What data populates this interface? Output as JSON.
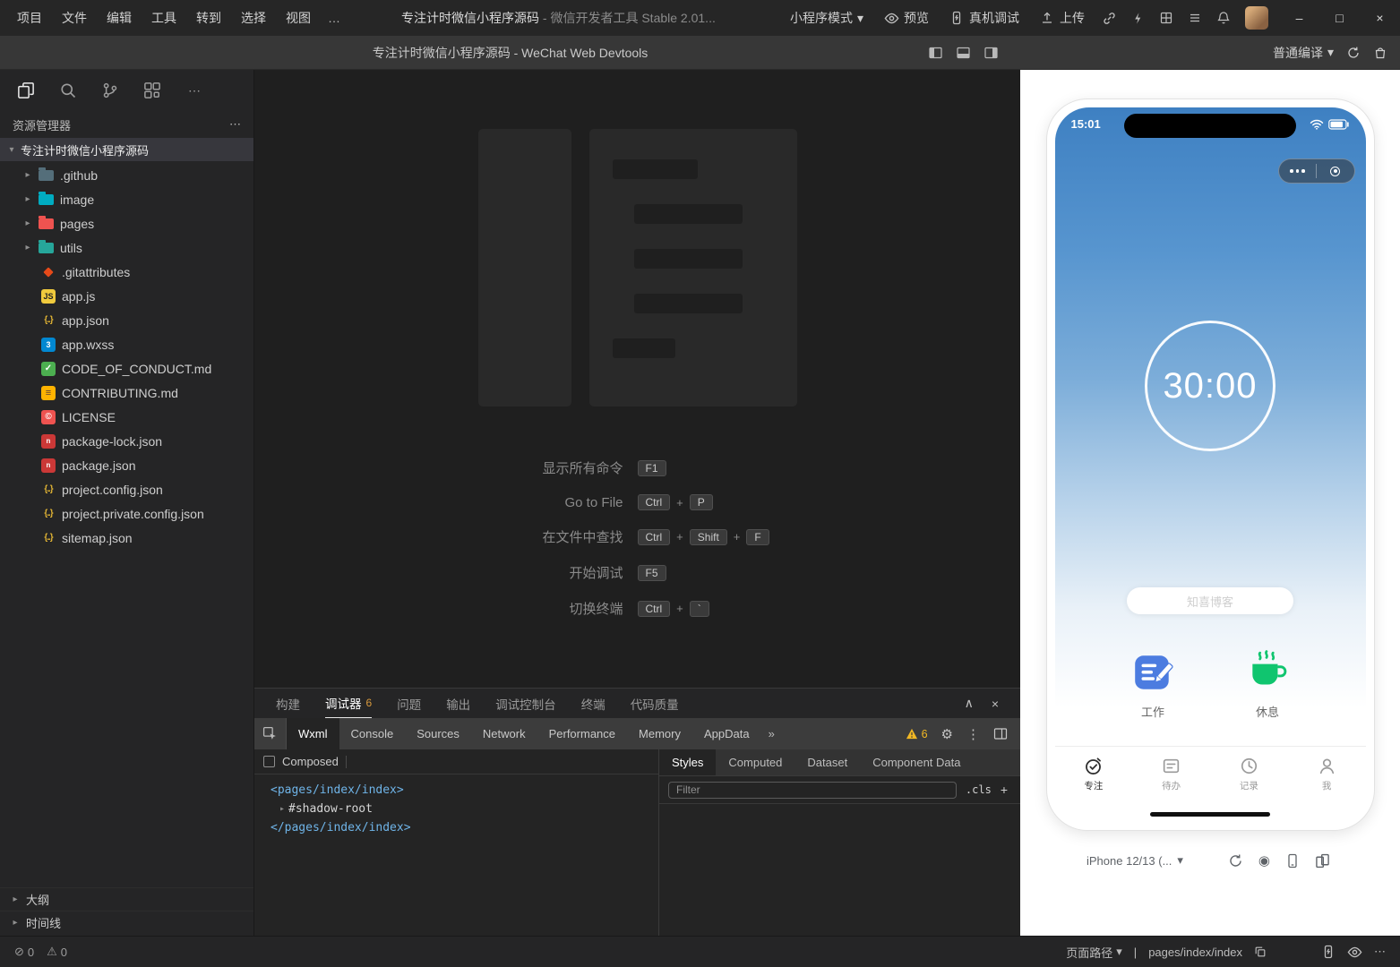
{
  "glyphs": {
    "more_h": "…",
    "kebab": "⋮",
    "dots": "⋯",
    "caret_down": "▾",
    "twisty_closed": "▸",
    "twisty_open": "▾",
    "plus": "+",
    "chevrons": "»",
    "collapse": "∧",
    "close": "×",
    "minimize": "–",
    "maximize": "□",
    "divider": "|",
    "error_icon": "⊘",
    "warning_icon": "⚠",
    "record": "◉"
  },
  "menubar": {
    "items": [
      "项目",
      "文件",
      "编辑",
      "工具",
      "转到",
      "选择",
      "视图"
    ],
    "project": "专注计时微信小程序源码",
    "sep": "-",
    "app": "微信开发者工具 Stable 2.01...",
    "mode": "小程序模式",
    "preview": "预览",
    "remote_debug": "真机调试",
    "upload": "上传"
  },
  "titlebar": {
    "title": "专注计时微信小程序源码 - WeChat Web Devtools",
    "compile": "普通编译"
  },
  "sidebar": {
    "explorer": "资源管理器",
    "root": "专注计时微信小程序源码",
    "folders": [
      ".github",
      "image",
      "pages",
      "utils"
    ],
    "files": [
      ".gitattributes",
      "app.js",
      "app.json",
      "app.wxss",
      "CODE_OF_CONDUCT.md",
      "CONTRIBUTING.md",
      "LICENSE",
      "package-lock.json",
      "package.json",
      "project.config.json",
      "project.private.config.json",
      "sitemap.json"
    ],
    "outline": "大纲",
    "timeline": "时间线"
  },
  "editor": {
    "shortcuts": [
      {
        "label": "显示所有命令",
        "k1": "F1"
      },
      {
        "label": "Go to File",
        "k1": "Ctrl",
        "k2": "P"
      },
      {
        "label": "在文件中查找",
        "k1": "Ctrl",
        "k2": "Shift",
        "k3": "F"
      },
      {
        "label": "开始调试",
        "k1": "F5"
      },
      {
        "label": "切换终端",
        "k1": "Ctrl",
        "k2": "`"
      }
    ]
  },
  "panel": {
    "tabs": [
      "构建",
      "调试器",
      "问题",
      "输出",
      "调试控制台",
      "终端",
      "代码质量"
    ],
    "debugger_badge": "6",
    "devtools_tabs": [
      "Wxml",
      "Console",
      "Sources",
      "Network",
      "Performance",
      "Memory",
      "AppData"
    ],
    "warning_badge": "6",
    "composed": "Composed",
    "code_open": "<pages/index/index>",
    "code_shadow": "#shadow-root",
    "code_close": "</pages/index/index>",
    "styles_tabs": [
      "Styles",
      "Computed",
      "Dataset",
      "Component Data"
    ],
    "filter_placeholder": "Filter",
    "cls": ".cls"
  },
  "statusbar": {
    "errors": "0",
    "warnings": "0",
    "page_path_label": "页面路径",
    "page_path": "pages/index/index"
  },
  "simulator": {
    "time": "15:01",
    "timer": "30:00",
    "blog": "知喜博客",
    "work": "工作",
    "rest": "休息",
    "tabs": [
      "专注",
      "待办",
      "记录",
      "我"
    ],
    "device": "iPhone 12/13 (..."
  }
}
